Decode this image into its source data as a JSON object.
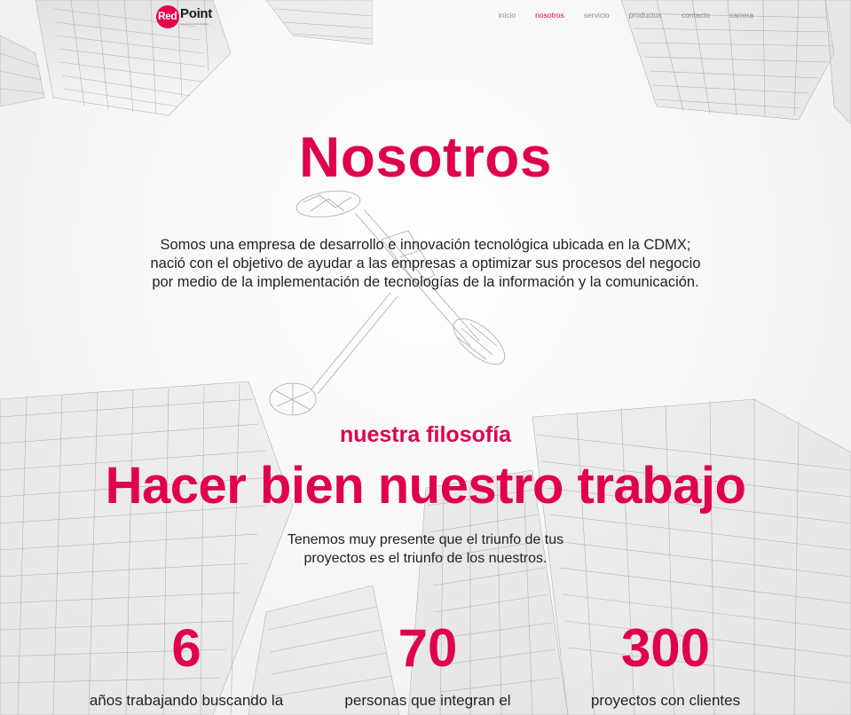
{
  "brand": {
    "name_red": "Red",
    "name_point": "Point",
    "tagline": "Soluciones tecnológicas"
  },
  "nav": {
    "items": [
      {
        "label": "inicio",
        "active": false
      },
      {
        "label": "nosotros",
        "active": true
      },
      {
        "label": "servicio",
        "active": false
      },
      {
        "label": "productos",
        "active": false
      },
      {
        "label": "contacto",
        "active": false
      },
      {
        "label": "carrera",
        "active": false
      }
    ]
  },
  "hero": {
    "title": "Nosotros",
    "intro_lines": [
      "Somos una empresa de desarrollo e innovación tecnológica ubicada en la CDMX;",
      "nació con el objetivo de ayudar a las empresas a optimizar sus procesos del negocio",
      "por medio de la implementación de tecnologías de la información y la comunicación."
    ]
  },
  "philosophy": {
    "label": "nuestra filosofía",
    "title": "Hacer bien nuestro trabajo",
    "text_lines": [
      "Tenemos muy presente que el triunfo de tus",
      "proyectos es el triunfo de los nuestros."
    ]
  },
  "stats": [
    {
      "number": "6",
      "description": "años trabajando buscando la"
    },
    {
      "number": "70",
      "description": "personas que integran el"
    },
    {
      "number": "300",
      "description": "proyectos con clientes"
    }
  ],
  "colors": {
    "accent": "#e0004d",
    "text": "#222222",
    "nav_text": "#8a8a8a"
  }
}
